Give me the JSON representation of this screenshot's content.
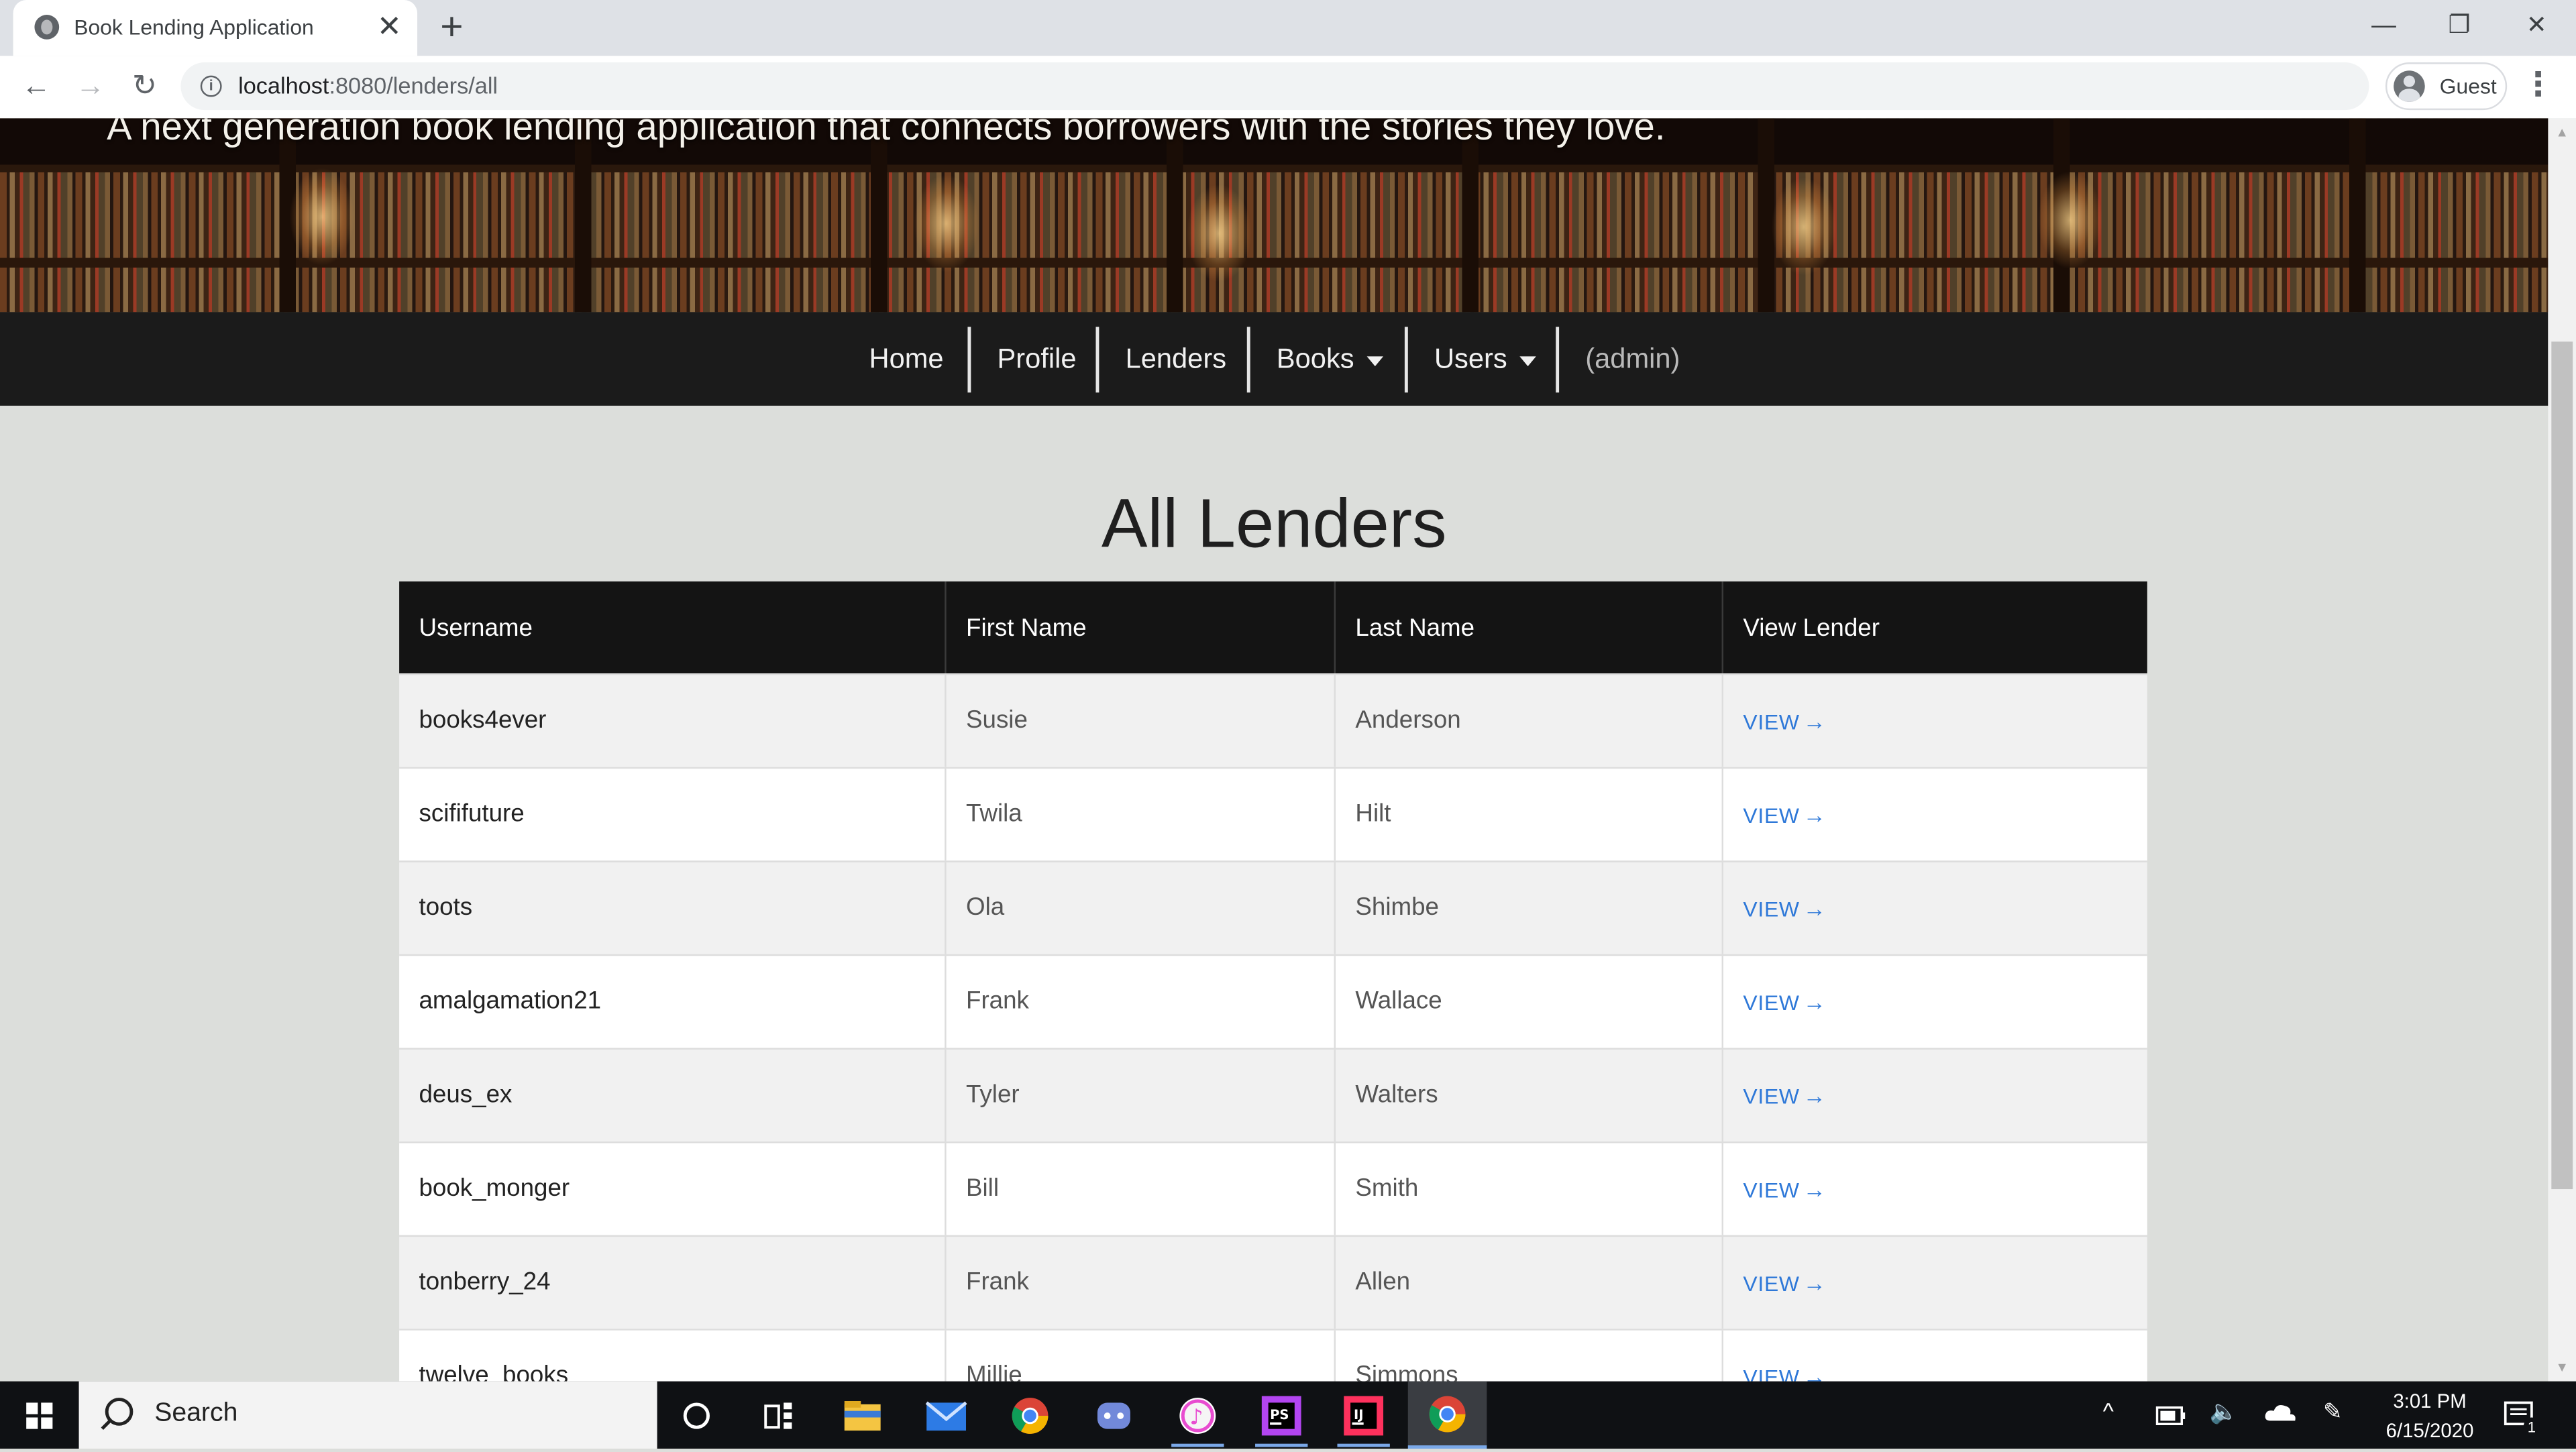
{
  "browser": {
    "tab_title": "Book Lending Application",
    "tab_close": "✕",
    "new_tab": "+",
    "url_host": "localhost",
    "url_path": ":8080/lenders/all",
    "profile_label": "Guest"
  },
  "page": {
    "tagline": "A next generation book lending application that connects borrowers with the stories they love.",
    "nav": {
      "home": "Home",
      "profile": "Profile",
      "lenders": "Lenders",
      "books": "Books",
      "users": "Users",
      "admin": "(admin)"
    },
    "heading": "All Lenders",
    "table": {
      "columns": [
        "Username",
        "First Name",
        "Last Name",
        "View Lender"
      ],
      "rows": [
        {
          "username": "books4ever",
          "first": "Susie",
          "last": "Anderson",
          "action": "VIEW"
        },
        {
          "username": "scififuture",
          "first": "Twila",
          "last": "Hilt",
          "action": "VIEW"
        },
        {
          "username": "toots",
          "first": "Ola",
          "last": "Shimbe",
          "action": "VIEW"
        },
        {
          "username": "amalgamation21",
          "first": "Frank",
          "last": "Wallace",
          "action": "VIEW"
        },
        {
          "username": "deus_ex",
          "first": "Tyler",
          "last": "Walters",
          "action": "VIEW"
        },
        {
          "username": "book_monger",
          "first": "Bill",
          "last": "Smith",
          "action": "VIEW"
        },
        {
          "username": "tonberry_24",
          "first": "Frank",
          "last": "Allen",
          "action": "VIEW"
        },
        {
          "username": "twelve_books",
          "first": "Millie",
          "last": "Simmons",
          "action": "VIEW"
        }
      ]
    }
  },
  "taskbar": {
    "search_placeholder": "Search",
    "time": "3:01 PM",
    "date": "6/15/2020",
    "notification_count": "1"
  },
  "colors": {
    "link": "#2e78d8",
    "nav_bg": "#1b1b1b",
    "table_header_bg": "#141414",
    "page_bg": "#dcdedb"
  }
}
